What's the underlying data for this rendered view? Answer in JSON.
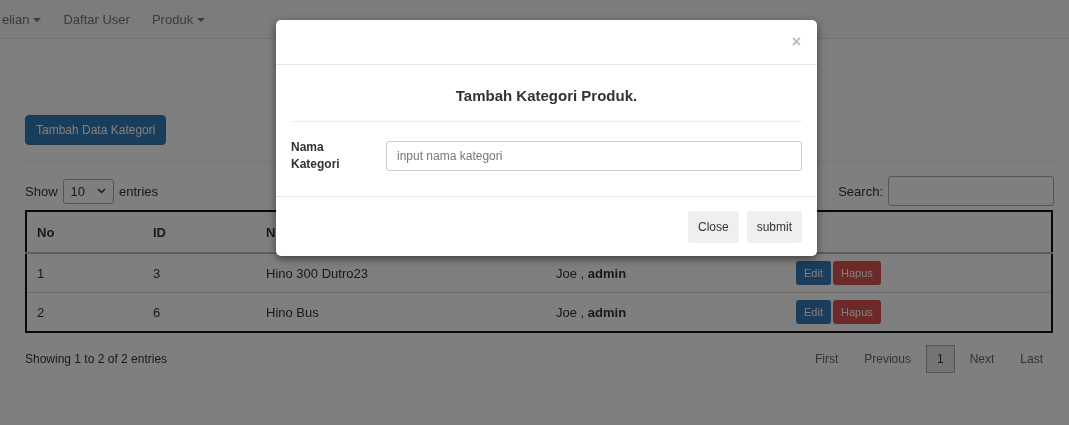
{
  "navbar": {
    "items": [
      {
        "label": "elian",
        "dropdown": true
      },
      {
        "label": "Daftar User",
        "dropdown": false
      },
      {
        "label": "Produk",
        "dropdown": true
      }
    ]
  },
  "add_button": "Tambah Data Kategori",
  "length_control": {
    "before": "Show",
    "value": "10",
    "after": "entries"
  },
  "search": {
    "label": "Search:"
  },
  "table": {
    "columns": [
      "No",
      "ID",
      "N"
    ],
    "rows": [
      {
        "no": "1",
        "id": "3",
        "name": "Hino 300 Dutro23",
        "user": "Joe , ",
        "role": "admin",
        "actions": [
          "Edit",
          "Hapus"
        ]
      },
      {
        "no": "2",
        "id": "6",
        "name": "Hino Bus",
        "user": "Joe , ",
        "role": "admin",
        "actions": [
          "Edit",
          "Hapus"
        ]
      }
    ]
  },
  "info": "Showing 1 to 2 of 2 entries",
  "pagination": [
    {
      "label": "First",
      "selected": false
    },
    {
      "label": "Previous",
      "selected": false
    },
    {
      "label": "1",
      "selected": true
    },
    {
      "label": "Next",
      "selected": false
    },
    {
      "label": "Last",
      "selected": false
    }
  ],
  "modal": {
    "close_icon": "×",
    "title": "Tambah Kategori Produk.",
    "field_label": "Nama Kategori",
    "placeholder": "input nama kategori",
    "buttons": [
      "Close",
      "submit"
    ]
  }
}
